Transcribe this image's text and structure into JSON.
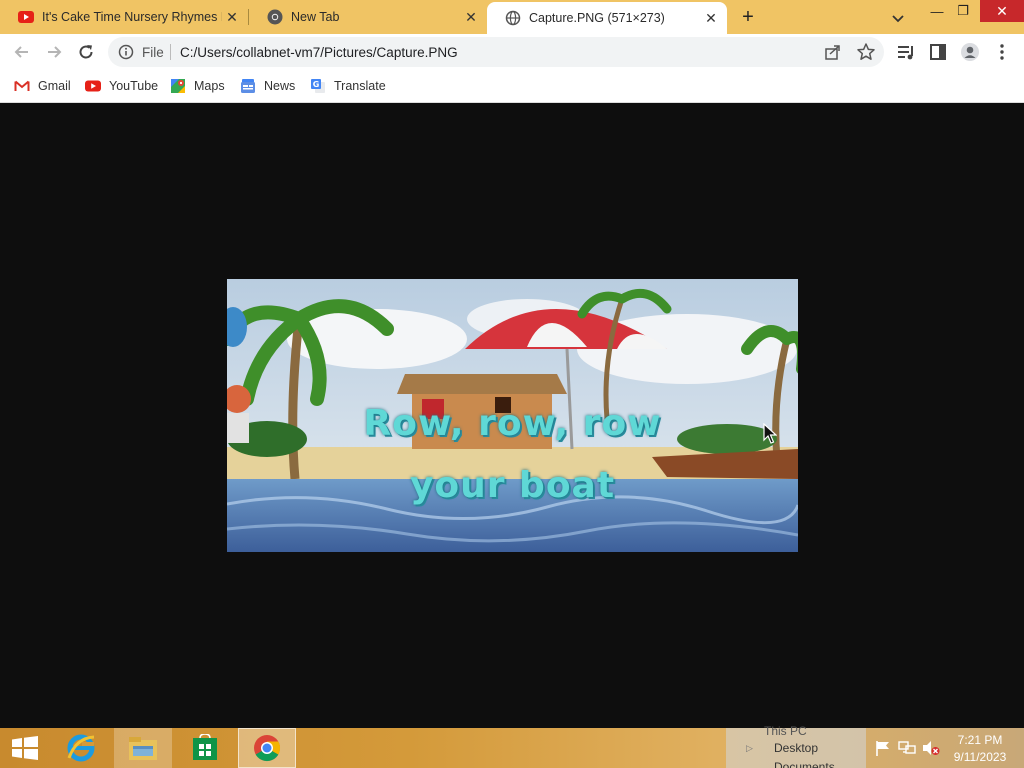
{
  "browser": {
    "tabs": [
      {
        "title": "It's Cake Time Nursery Rhymes F",
        "icon": "youtube-icon",
        "active": false
      },
      {
        "title": "New Tab",
        "icon": "chrome-icon",
        "active": false
      },
      {
        "title": "Capture.PNG (571×273)",
        "icon": "globe-icon",
        "active": true
      }
    ],
    "new_tab_label": "+",
    "close_glyph": "✕",
    "window_controls": {
      "minimize": "—",
      "maximize": "❐",
      "close": "✕"
    }
  },
  "toolbar": {
    "scheme": "File",
    "url": "C:/Users/collabnet-vm7/Pictures/Capture.PNG"
  },
  "bookmarks": [
    {
      "label": "Gmail",
      "icon": "gmail-icon"
    },
    {
      "label": "YouTube",
      "icon": "youtube-icon"
    },
    {
      "label": "Maps",
      "icon": "maps-icon"
    },
    {
      "label": "News",
      "icon": "news-icon"
    },
    {
      "label": "Translate",
      "icon": "translate-icon"
    }
  ],
  "image": {
    "caption_line1": "Row, row, row",
    "caption_line2": "your boat"
  },
  "taskbar": {
    "peek": {
      "this_pc": "This PC",
      "desktop": "Desktop",
      "documents": "Documents"
    },
    "clock": {
      "time": "7:21 PM",
      "date": "9/11/2023"
    }
  },
  "colors": {
    "tabstrip": "#f0c464",
    "close_red": "#c7282b",
    "caption": "#5fd8d6"
  }
}
